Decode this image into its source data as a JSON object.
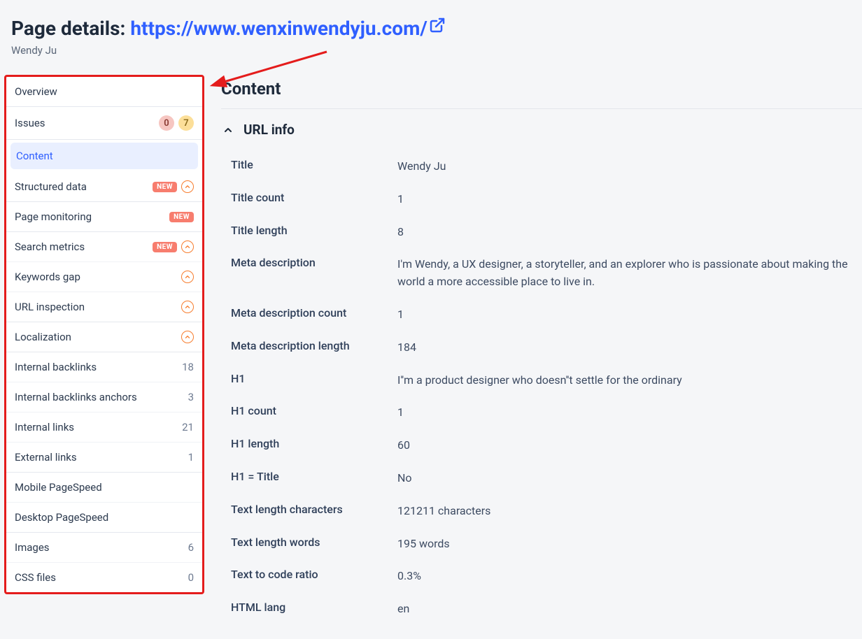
{
  "header": {
    "title_prefix": "Page details: ",
    "url": "https://www.wenxinwendyju.com/",
    "subtitle": "Wendy Ju"
  },
  "sidebar": {
    "groups": [
      {
        "items": [
          {
            "label": "Overview",
            "right": []
          }
        ]
      },
      {
        "items": [
          {
            "label": "Issues",
            "right": [
              {
                "type": "pill-red",
                "text": "0"
              },
              {
                "type": "pill-yellow",
                "text": "7"
              }
            ]
          }
        ]
      },
      {
        "items": [
          {
            "label": "Content",
            "active": true,
            "right": []
          },
          {
            "label": "Structured data",
            "right": [
              {
                "type": "new"
              },
              {
                "type": "up"
              }
            ]
          }
        ]
      },
      {
        "items": [
          {
            "label": "Page monitoring",
            "right": [
              {
                "type": "new"
              }
            ]
          }
        ]
      },
      {
        "items": [
          {
            "label": "Search metrics",
            "right": [
              {
                "type": "new"
              },
              {
                "type": "up"
              }
            ]
          },
          {
            "label": "Keywords gap",
            "right": [
              {
                "type": "up"
              }
            ]
          },
          {
            "label": "URL inspection",
            "right": [
              {
                "type": "up"
              }
            ]
          }
        ]
      },
      {
        "items": [
          {
            "label": "Localization",
            "right": [
              {
                "type": "up"
              }
            ]
          }
        ]
      },
      {
        "items": [
          {
            "label": "Internal backlinks",
            "right": [
              {
                "type": "count",
                "text": "18"
              }
            ]
          },
          {
            "label": "Internal backlinks anchors",
            "right": [
              {
                "type": "count",
                "text": "3"
              }
            ]
          },
          {
            "label": "Internal links",
            "right": [
              {
                "type": "count",
                "text": "21"
              }
            ]
          },
          {
            "label": "External links",
            "right": [
              {
                "type": "count",
                "text": "1"
              }
            ]
          }
        ]
      },
      {
        "items": [
          {
            "label": "Mobile PageSpeed",
            "right": []
          },
          {
            "label": "Desktop PageSpeed",
            "right": []
          }
        ]
      },
      {
        "items": [
          {
            "label": "Images",
            "right": [
              {
                "type": "count",
                "text": "6"
              }
            ]
          },
          {
            "label": "CSS files",
            "right": [
              {
                "type": "count",
                "text": "0"
              }
            ]
          }
        ]
      }
    ]
  },
  "content": {
    "heading": "Content",
    "section_title": "URL info",
    "rows": [
      {
        "label": "Title",
        "value": "Wendy Ju"
      },
      {
        "label": "Title count",
        "value": "1"
      },
      {
        "label": "Title length",
        "value": "8"
      },
      {
        "label": "Meta description",
        "value": "I'm Wendy, a UX designer, a storyteller, and an explorer who is passionate about making the world a more accessible place to live in."
      },
      {
        "label": "Meta description count",
        "value": "1"
      },
      {
        "label": "Meta description length",
        "value": "184"
      },
      {
        "label": "H1",
        "value": "I''m a product designer who doesn''t settle for the ordinary"
      },
      {
        "label": "H1 count",
        "value": "1"
      },
      {
        "label": "H1 length",
        "value": "60"
      },
      {
        "label": "H1 = Title",
        "value": "No"
      },
      {
        "label": "Text length characters",
        "value": "121211 characters"
      },
      {
        "label": "Text length words",
        "value": "195 words"
      },
      {
        "label": "Text to code ratio",
        "value": "0.3%"
      },
      {
        "label": "HTML lang",
        "value": "en"
      }
    ]
  },
  "badges": {
    "new_text": "NEW"
  }
}
